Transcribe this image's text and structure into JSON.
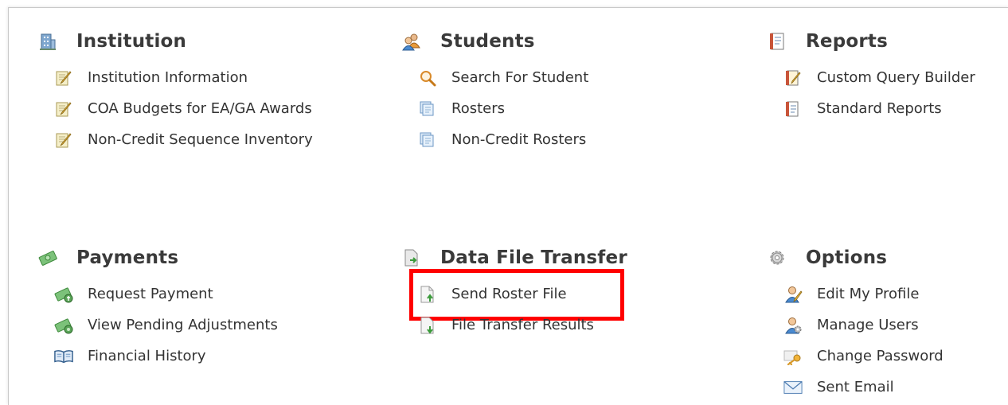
{
  "sections": {
    "institution": {
      "title": "Institution",
      "items": [
        {
          "label": "Institution Information"
        },
        {
          "label": "COA Budgets for EA/GA Awards"
        },
        {
          "label": "Non-Credit Sequence Inventory"
        }
      ]
    },
    "students": {
      "title": "Students",
      "items": [
        {
          "label": "Search For Student"
        },
        {
          "label": "Rosters"
        },
        {
          "label": "Non-Credit Rosters"
        }
      ]
    },
    "reports": {
      "title": "Reports",
      "items": [
        {
          "label": "Custom Query Builder"
        },
        {
          "label": "Standard Reports"
        }
      ]
    },
    "payments": {
      "title": "Payments",
      "items": [
        {
          "label": "Request Payment"
        },
        {
          "label": "View Pending Adjustments"
        },
        {
          "label": "Financial History"
        }
      ]
    },
    "data_file_transfer": {
      "title": "Data File Transfer",
      "items": [
        {
          "label": "Send Roster File"
        },
        {
          "label": "File Transfer Results"
        }
      ]
    },
    "options": {
      "title": "Options",
      "items": [
        {
          "label": "Edit My Profile"
        },
        {
          "label": "Manage Users"
        },
        {
          "label": "Change Password"
        },
        {
          "label": "Sent Email"
        }
      ]
    }
  },
  "highlight_color": "#ff0000"
}
